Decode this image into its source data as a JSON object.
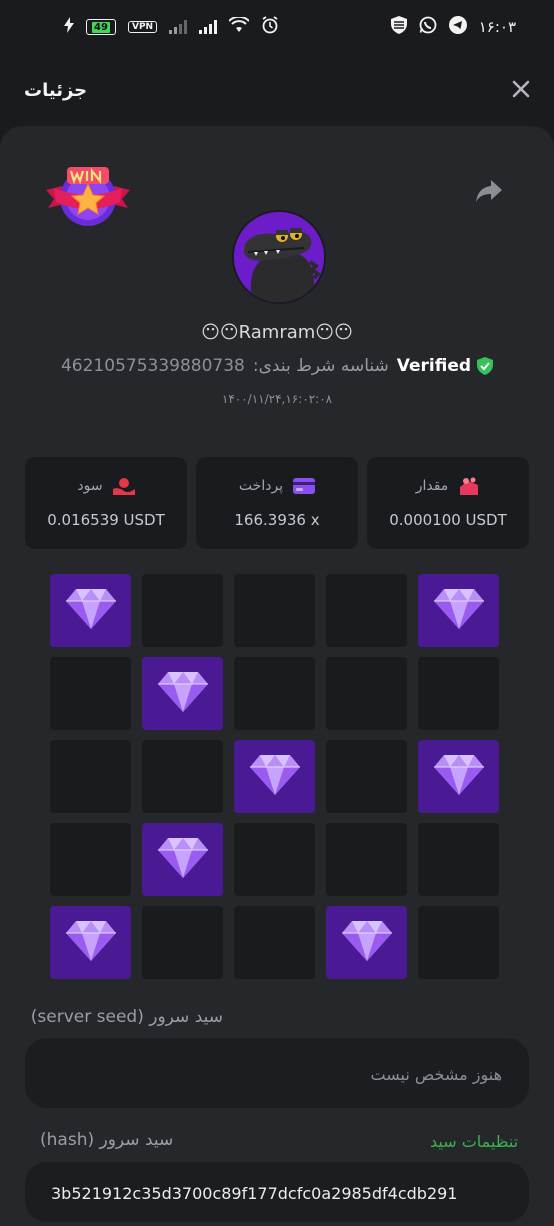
{
  "status_bar": {
    "battery": "49",
    "vpn": "VPN",
    "time": "۱۶:۰۳"
  },
  "header": {
    "title": "جزئیات"
  },
  "bet": {
    "username": "😶😶Ramram😶😶",
    "verified_label": "Verified",
    "bet_id_label": "شناسه شرط بندی:",
    "bet_id": "46210575339880738",
    "date": "۱۴۰۰/۱۱/۲۴,۱۶:۰۲:۰۸"
  },
  "stats": [
    {
      "label": "سود",
      "value": "0.016539 USDT",
      "icon": "profit-icon",
      "color": "#e5364a"
    },
    {
      "label": "پرداخت",
      "value": "166.3936 x",
      "icon": "payout-card-icon",
      "color": "#8a4ff0"
    },
    {
      "label": "مقدار",
      "value": "0.000100 USDT",
      "icon": "amount-icon",
      "color": "#e8385c"
    }
  ],
  "grid": {
    "rows": 5,
    "cols": 5,
    "gems": [
      0,
      4,
      6,
      12,
      14,
      16,
      20,
      23
    ]
  },
  "fields": {
    "server_seed_label": "سید سرور (server seed)",
    "server_seed_placeholder": "هنوز مشخص نیست",
    "hash_label": "سید سرور (hash)",
    "hash_value": "3b521912c35d3700c89f177dcfc0a2985df4cdb291",
    "seed_settings": "تنظیمات سید"
  },
  "colors": {
    "background": "#1a1b1f",
    "sheet": "#26272b",
    "gem_cell": "#4a1a94",
    "accent_green": "#38b44a"
  }
}
